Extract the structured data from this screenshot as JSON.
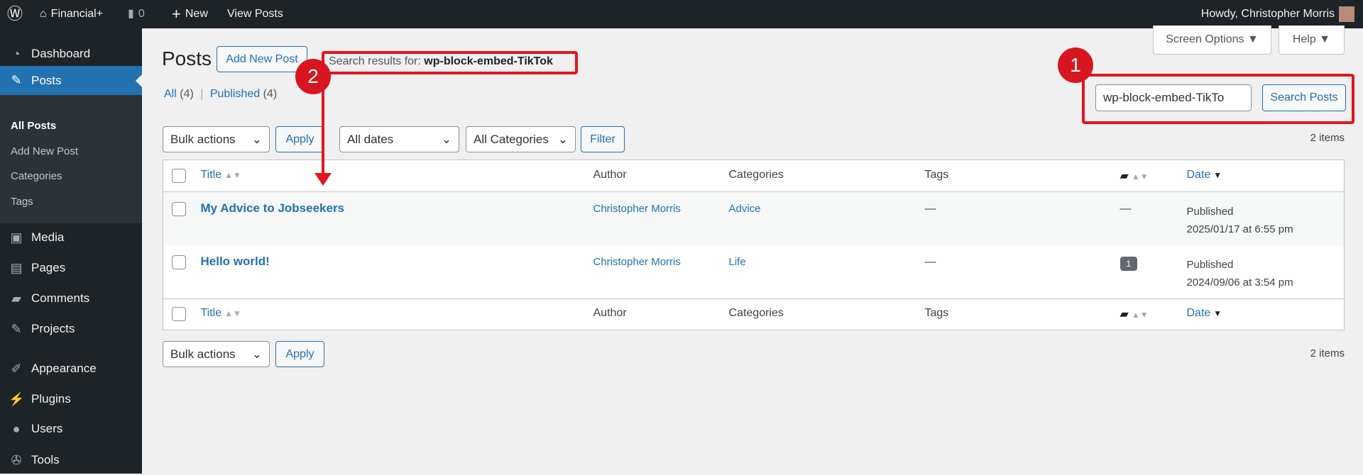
{
  "adminbar": {
    "site": "Financial+",
    "comments": "0",
    "new": "New",
    "view": "View Posts",
    "howdy": "Howdy, Christopher Morris"
  },
  "sidebar": {
    "items": [
      {
        "label": "Dashboard",
        "icon": "dashboard-icon"
      },
      {
        "label": "Posts",
        "icon": "pin-icon"
      },
      {
        "label": "Media",
        "icon": "media-icon"
      },
      {
        "label": "Pages",
        "icon": "pages-icon"
      },
      {
        "label": "Comments",
        "icon": "comments-icon"
      },
      {
        "label": "Projects",
        "icon": "pin-icon"
      },
      {
        "label": "Appearance",
        "icon": "brush-icon"
      },
      {
        "label": "Plugins",
        "icon": "plugin-icon"
      },
      {
        "label": "Users",
        "icon": "user-icon"
      },
      {
        "label": "Tools",
        "icon": "wrench-icon"
      }
    ],
    "submenu": [
      "All Posts",
      "Add New Post",
      "Categories",
      "Tags"
    ]
  },
  "header": {
    "title": "Posts",
    "add_new": "Add New Post",
    "search_prefix": "Search results for: ",
    "search_term": "wp-block-embed-TikTok",
    "screen_options": "Screen Options ▼",
    "help": "Help ▼"
  },
  "views": {
    "all": "All",
    "all_count": "(4)",
    "sep": "|",
    "published": "Published",
    "published_count": "(4)"
  },
  "search": {
    "value": "wp-block-embed-TikTo",
    "button": "Search Posts"
  },
  "filters": {
    "bulk": "Bulk actions",
    "apply": "Apply",
    "dates": "All dates",
    "categories": "All Categories",
    "filter": "Filter",
    "count": "2 items"
  },
  "table": {
    "headers": {
      "title": "Title",
      "author": "Author",
      "categories": "Categories",
      "tags": "Tags",
      "date": "Date"
    },
    "rows": [
      {
        "title": "My Advice to Jobseekers",
        "author": "Christopher Morris",
        "category": "Advice",
        "tags": "—",
        "comments": "—",
        "status": "Published",
        "date": "2025/01/17 at 6:55 pm"
      },
      {
        "title": "Hello world!",
        "author": "Christopher Morris",
        "category": "Life",
        "tags": "—",
        "comments": "1",
        "status": "Published",
        "date": "2024/09/06 at 3:54 pm"
      }
    ]
  },
  "annotations": {
    "one": "1",
    "two": "2",
    "color": "#e3151f"
  }
}
